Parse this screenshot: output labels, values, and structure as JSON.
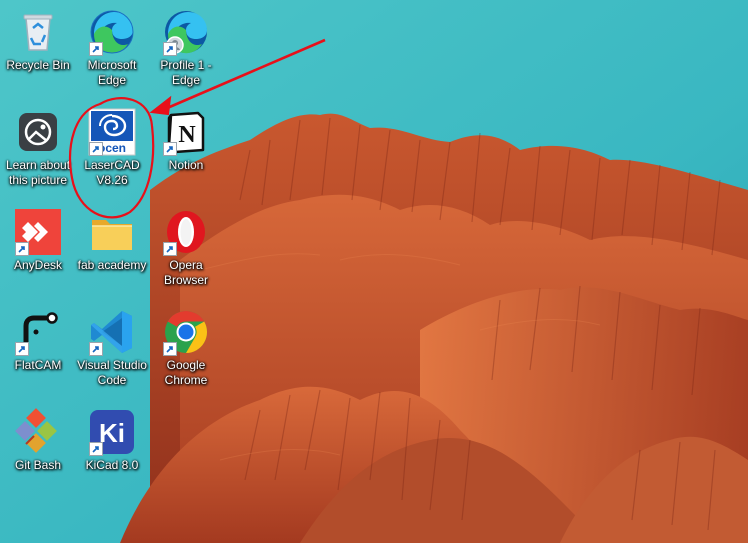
{
  "desktop": {
    "icons": [
      {
        "label": "Recycle Bin",
        "icon": "recycle-bin-icon",
        "shortcut": false
      },
      {
        "label": "Microsoft Edge",
        "icon": "edge-icon",
        "shortcut": true
      },
      {
        "label": "Profile 1 - Edge",
        "icon": "edge-profile-icon",
        "shortcut": true
      },
      {
        "label": "Learn about this picture",
        "icon": "camera-icon",
        "shortcut": false
      },
      {
        "label": "LaserCAD V8.26",
        "icon": "lasercad-icon",
        "shortcut": true,
        "logo_text": "ocen"
      },
      {
        "label": "Notion",
        "icon": "notion-icon",
        "shortcut": true,
        "logo_text": "N"
      },
      {
        "label": "AnyDesk",
        "icon": "anydesk-icon",
        "shortcut": true
      },
      {
        "label": "fab academy",
        "icon": "folder-icon",
        "shortcut": false
      },
      {
        "label": "Opera Browser",
        "icon": "opera-icon",
        "shortcut": true
      },
      {
        "label": "FlatCAM",
        "icon": "flatcam-icon",
        "shortcut": true
      },
      {
        "label": "Visual Studio Code",
        "icon": "vscode-icon",
        "shortcut": true
      },
      {
        "label": "Google Chrome",
        "icon": "chrome-icon",
        "shortcut": true
      },
      {
        "label": "Git Bash",
        "icon": "git-bash-icon",
        "shortcut": false
      },
      {
        "label": "KiCad 8.0",
        "icon": "kicad-icon",
        "shortcut": true,
        "logo_text": "Ki"
      }
    ]
  },
  "annotation": {
    "color": "#e8101a",
    "target": "LaserCAD V8.26"
  },
  "colors": {
    "sky": "#4fc3c6",
    "rock": "#b4462a",
    "label_text": "#ffffff"
  }
}
